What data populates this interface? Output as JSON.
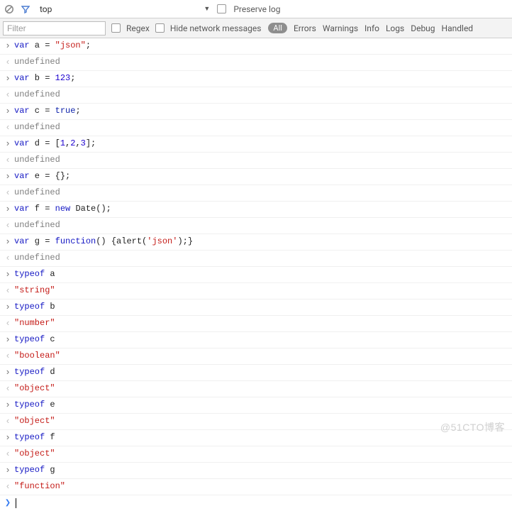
{
  "toolbar1": {
    "context_label": "top",
    "preserve_log_label": "Preserve log"
  },
  "toolbar2": {
    "filter_placeholder": "Filter",
    "regex_label": "Regex",
    "hide_network_label": "Hide network messages",
    "levels": {
      "all": "All",
      "errors": "Errors",
      "warnings": "Warnings",
      "info": "Info",
      "logs": "Logs",
      "debug": "Debug",
      "handled": "Handled"
    }
  },
  "lines": [
    {
      "marker": "in",
      "tokens": [
        [
          "kw",
          "var"
        ],
        [
          "pun",
          " a "
        ],
        [
          "pun",
          "= "
        ],
        [
          "str",
          "\"json\""
        ],
        [
          "pun",
          ";"
        ]
      ]
    },
    {
      "marker": "out",
      "tokens": [
        [
          "undef",
          "undefined"
        ]
      ]
    },
    {
      "marker": "in",
      "tokens": [
        [
          "kw",
          "var"
        ],
        [
          "pun",
          " b "
        ],
        [
          "pun",
          "= "
        ],
        [
          "num",
          "123"
        ],
        [
          "pun",
          ";"
        ]
      ]
    },
    {
      "marker": "out",
      "tokens": [
        [
          "undef",
          "undefined"
        ]
      ]
    },
    {
      "marker": "in",
      "tokens": [
        [
          "kw",
          "var"
        ],
        [
          "pun",
          " c "
        ],
        [
          "pun",
          "= "
        ],
        [
          "bool",
          "true"
        ],
        [
          "pun",
          ";"
        ]
      ]
    },
    {
      "marker": "out",
      "tokens": [
        [
          "undef",
          "undefined"
        ]
      ]
    },
    {
      "marker": "in",
      "tokens": [
        [
          "kw",
          "var"
        ],
        [
          "pun",
          " d "
        ],
        [
          "pun",
          "= ["
        ],
        [
          "num",
          "1"
        ],
        [
          "pun",
          ","
        ],
        [
          "num",
          "2"
        ],
        [
          "pun",
          ","
        ],
        [
          "num",
          "3"
        ],
        [
          "pun",
          "];"
        ]
      ]
    },
    {
      "marker": "out",
      "tokens": [
        [
          "undef",
          "undefined"
        ]
      ]
    },
    {
      "marker": "in",
      "tokens": [
        [
          "kw",
          "var"
        ],
        [
          "pun",
          " e "
        ],
        [
          "pun",
          "= {};"
        ]
      ]
    },
    {
      "marker": "out",
      "tokens": [
        [
          "undef",
          "undefined"
        ]
      ]
    },
    {
      "marker": "in",
      "tokens": [
        [
          "kw",
          "var"
        ],
        [
          "pun",
          " f "
        ],
        [
          "pun",
          "= "
        ],
        [
          "kw",
          "new"
        ],
        [
          "pun",
          " "
        ],
        [
          "cls",
          "Date"
        ],
        [
          "pun",
          "();"
        ]
      ]
    },
    {
      "marker": "out",
      "tokens": [
        [
          "undef",
          "undefined"
        ]
      ]
    },
    {
      "marker": "in",
      "tokens": [
        [
          "kw",
          "var"
        ],
        [
          "pun",
          " g "
        ],
        [
          "pun",
          "= "
        ],
        [
          "kw",
          "function"
        ],
        [
          "pun",
          "() {alert("
        ],
        [
          "str",
          "'json'"
        ],
        [
          "pun",
          ");}"
        ]
      ]
    },
    {
      "marker": "out",
      "tokens": [
        [
          "undef",
          "undefined"
        ]
      ]
    },
    {
      "marker": "in",
      "tokens": [
        [
          "kw",
          "typeof"
        ],
        [
          "pun",
          " a"
        ]
      ]
    },
    {
      "marker": "out",
      "tokens": [
        [
          "res-str",
          "\"string\""
        ]
      ]
    },
    {
      "marker": "in",
      "tokens": [
        [
          "kw",
          "typeof"
        ],
        [
          "pun",
          " b"
        ]
      ]
    },
    {
      "marker": "out",
      "tokens": [
        [
          "res-str",
          "\"number\""
        ]
      ]
    },
    {
      "marker": "in",
      "tokens": [
        [
          "kw",
          "typeof"
        ],
        [
          "pun",
          " c"
        ]
      ]
    },
    {
      "marker": "out",
      "tokens": [
        [
          "res-str",
          "\"boolean\""
        ]
      ]
    },
    {
      "marker": "in",
      "tokens": [
        [
          "kw",
          "typeof"
        ],
        [
          "pun",
          " d"
        ]
      ]
    },
    {
      "marker": "out",
      "tokens": [
        [
          "res-str",
          "\"object\""
        ]
      ]
    },
    {
      "marker": "in",
      "tokens": [
        [
          "kw",
          "typeof"
        ],
        [
          "pun",
          " e"
        ]
      ]
    },
    {
      "marker": "out",
      "tokens": [
        [
          "res-str",
          "\"object\""
        ]
      ]
    },
    {
      "marker": "in",
      "tokens": [
        [
          "kw",
          "typeof"
        ],
        [
          "pun",
          " f"
        ]
      ]
    },
    {
      "marker": "out",
      "tokens": [
        [
          "res-str",
          "\"object\""
        ]
      ]
    },
    {
      "marker": "in",
      "tokens": [
        [
          "kw",
          "typeof"
        ],
        [
          "pun",
          " g"
        ]
      ]
    },
    {
      "marker": "out",
      "tokens": [
        [
          "res-str",
          "\"function\""
        ]
      ]
    }
  ],
  "watermark": "@51CTO博客"
}
